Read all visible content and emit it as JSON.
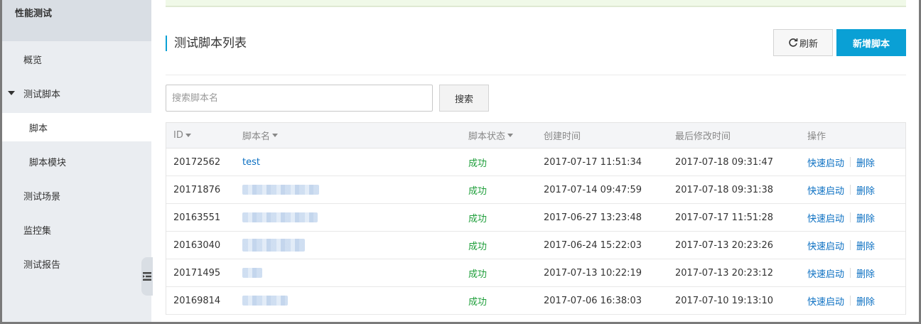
{
  "sidebar": {
    "title": "性能测试",
    "items": [
      {
        "label": "概览"
      },
      {
        "label": "测试脚本"
      },
      {
        "label": "脚本"
      },
      {
        "label": "脚本模块"
      },
      {
        "label": "测试场景"
      },
      {
        "label": "监控集"
      },
      {
        "label": "测试报告"
      }
    ]
  },
  "header": {
    "title": "测试脚本列表",
    "refresh_label": "刷新",
    "new_label": "新增脚本"
  },
  "search": {
    "placeholder": "搜索脚本名",
    "button_label": "搜索"
  },
  "table": {
    "columns": {
      "id": "ID",
      "name": "脚本名",
      "status": "脚本状态",
      "created": "创建时间",
      "modified": "最后修改时间",
      "ops": "操作"
    },
    "rows": [
      {
        "id": "20172562",
        "name": "test",
        "status": "成功",
        "created": "2017-07-17 11:51:34",
        "modified": "2017-07-18 09:31:47",
        "op_launch": "快速启动",
        "op_delete": "删除"
      },
      {
        "id": "20171876",
        "name": "",
        "status": "成功",
        "created": "2017-07-14 09:47:59",
        "modified": "2017-07-18 09:31:38",
        "op_launch": "快速启动",
        "op_delete": "删除"
      },
      {
        "id": "20163551",
        "name": "",
        "status": "成功",
        "created": "2017-06-27 13:23:48",
        "modified": "2017-07-17 11:51:28",
        "op_launch": "快速启动",
        "op_delete": "删除"
      },
      {
        "id": "20163040",
        "name": "",
        "status": "成功",
        "created": "2017-06-24 15:22:03",
        "modified": "2017-07-13 20:23:26",
        "op_launch": "快速启动",
        "op_delete": "删除"
      },
      {
        "id": "20171495",
        "name": "",
        "status": "成功",
        "created": "2017-07-13 10:22:19",
        "modified": "2017-07-13 20:23:12",
        "op_launch": "快速启动",
        "op_delete": "删除"
      },
      {
        "id": "20169814",
        "name": "",
        "status": "成功",
        "created": "2017-07-06 16:38:03",
        "modified": "2017-07-10 19:13:10",
        "op_launch": "快速启动",
        "op_delete": "删除"
      }
    ]
  },
  "colors": {
    "accent": "#0aa0d5",
    "link": "#0a6fc2",
    "success": "#1e9e3a",
    "sidebar_bg": "#eaedf1"
  },
  "icons": {
    "refresh": "refresh-icon",
    "caret": "caret-down-icon",
    "collapse": "sidebar-collapse-icon"
  }
}
